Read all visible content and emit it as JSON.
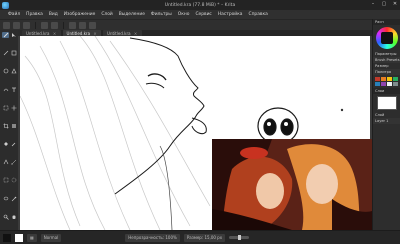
{
  "window": {
    "title": "Untitled.kra (77.8 MiB) * – Krita",
    "controls": [
      "–",
      "▢",
      "✕"
    ]
  },
  "menu": [
    "Файл",
    "Правка",
    "Вид",
    "Изображение",
    "Слой",
    "Выделение",
    "Фильтры",
    "Окно",
    "Сервис",
    "Настройка",
    "Справка"
  ],
  "tabs": [
    {
      "label": "Untitled.kra",
      "active": false
    },
    {
      "label": "Untitled.kra",
      "active": true
    },
    {
      "label": "Untitled.kra",
      "active": false
    }
  ],
  "tools": [
    "pointer-icon",
    "brush-icon",
    "line-icon",
    "rect-icon",
    "ellipse-icon",
    "polygon-icon",
    "freehand-path-icon",
    "text-icon",
    "transform-icon",
    "move-icon",
    "crop-icon",
    "gradient-icon",
    "fill-icon",
    "eyedropper-icon",
    "assistant-icon",
    "measure-icon",
    "rect-select-icon",
    "ellipse-select-icon",
    "lasso-icon",
    "magic-wand-icon",
    "zoom-icon",
    "pan-icon"
  ],
  "dockers": {
    "color_title": "Расп",
    "rows": [
      "Параметры",
      "Brush Presets",
      "Размер",
      "Палитра"
    ],
    "swatches": [
      "#c0392b",
      "#e67e22",
      "#f1c40f",
      "#27ae60",
      "#2980b9",
      "#8e44ad",
      "#ecf0f1",
      "#7f8c8d",
      "#d35400",
      "#16a085",
      "#2c3e50",
      "#bdc3c7"
    ],
    "layers_title": "Слои",
    "layer_rows": [
      "Слой",
      "Layer 1"
    ]
  },
  "status": {
    "tool_name": "Normal",
    "opacity": "Непрозрачность: 100%",
    "size": "Размер: 15,00 px",
    "fg_color": "#111111",
    "bg_color": "#ffffff"
  }
}
